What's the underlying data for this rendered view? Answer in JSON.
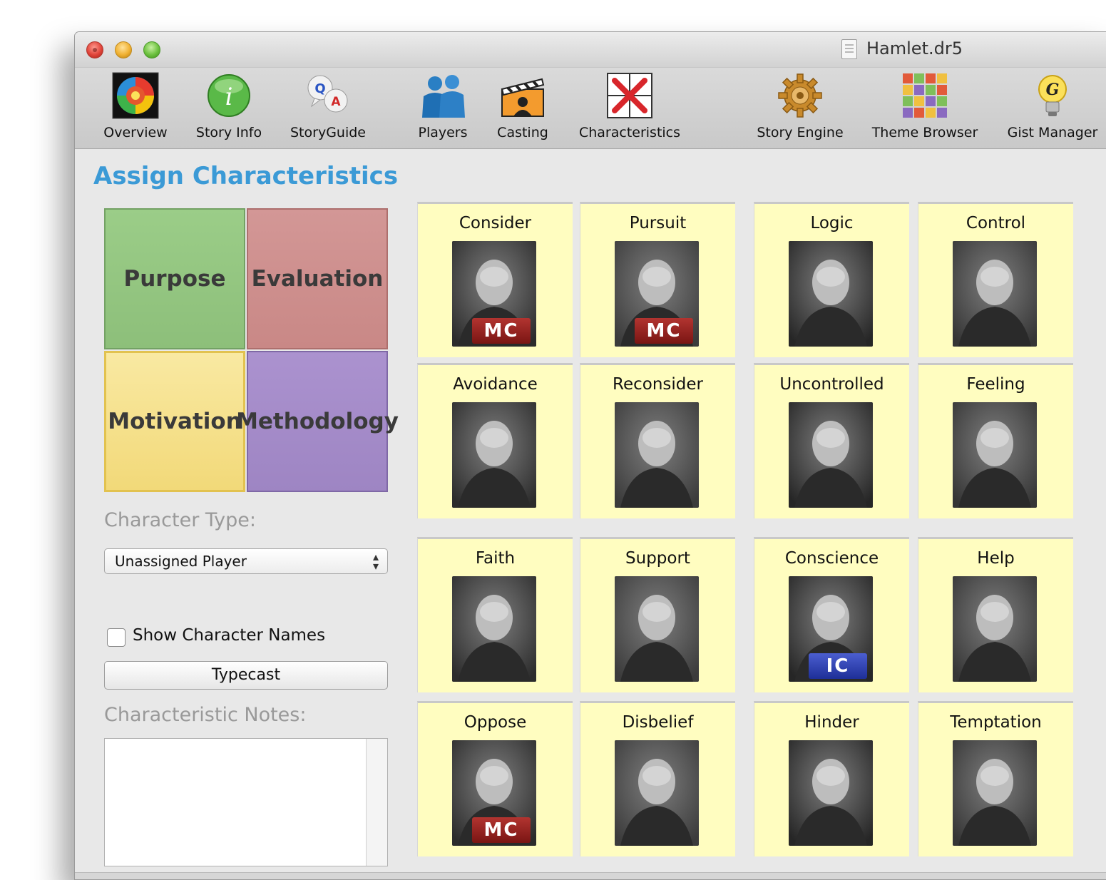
{
  "window": {
    "title": "Hamlet.dr5"
  },
  "toolbar": {
    "items": [
      {
        "label": "Overview",
        "icon": "overview-icon"
      },
      {
        "label": "Story Info",
        "icon": "info-icon"
      },
      {
        "label": "StoryGuide",
        "icon": "qa-icon"
      },
      {
        "label": "Players",
        "icon": "players-icon"
      },
      {
        "label": "Casting",
        "icon": "clapperboard-icon"
      },
      {
        "label": "Characteristics",
        "icon": "characteristics-icon"
      },
      {
        "label": "Story Engine",
        "icon": "gear-icon"
      },
      {
        "label": "Theme Browser",
        "icon": "grid-icon"
      },
      {
        "label": "Gist Manager",
        "icon": "lightbulb-icon"
      }
    ]
  },
  "panel": {
    "title": "Assign Characteristics",
    "quadrants": {
      "purpose": "Purpose",
      "evaluation": "Evaluation",
      "motivation": "Motivation",
      "methodology": "Methodology"
    },
    "character_type_label": "Character Type:",
    "character_type_value": "Unassigned Player",
    "show_names_label": "Show Character Names",
    "show_names_checked": false,
    "typecast_label": "Typecast",
    "notes_label": "Characteristic Notes:",
    "notes_value": ""
  },
  "grid": {
    "cards": [
      {
        "name": "Consider",
        "badge": "MC"
      },
      {
        "name": "Pursuit",
        "badge": "MC"
      },
      {
        "name": "Logic",
        "badge": ""
      },
      {
        "name": "Control",
        "badge": ""
      },
      {
        "name": "Avoidance",
        "badge": ""
      },
      {
        "name": "Reconsider",
        "badge": ""
      },
      {
        "name": "Uncontrolled",
        "badge": ""
      },
      {
        "name": "Feeling",
        "badge": ""
      },
      {
        "name": "Faith",
        "badge": ""
      },
      {
        "name": "Support",
        "badge": ""
      },
      {
        "name": "Conscience",
        "badge": "IC"
      },
      {
        "name": "Help",
        "badge": ""
      },
      {
        "name": "Oppose",
        "badge": "MC"
      },
      {
        "name": "Disbelief",
        "badge": ""
      },
      {
        "name": "Hinder",
        "badge": ""
      },
      {
        "name": "Temptation",
        "badge": ""
      }
    ]
  }
}
